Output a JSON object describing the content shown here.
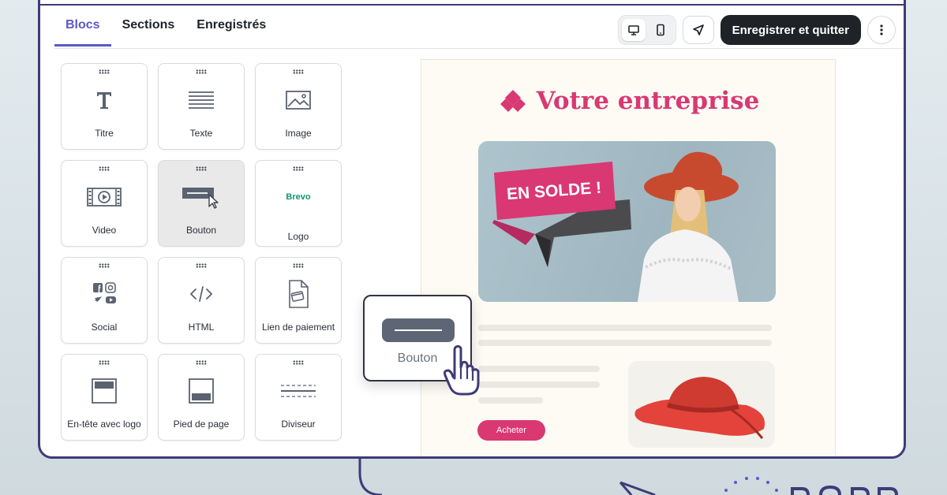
{
  "tabs": [
    "Blocs",
    "Sections",
    "Enregistrés"
  ],
  "toolbar": {
    "save_label": "Enregistrer et quitter"
  },
  "blocks": [
    {
      "label": "Titre"
    },
    {
      "label": "Texte"
    },
    {
      "label": "Image"
    },
    {
      "label": "Video"
    },
    {
      "label": "Bouton"
    },
    {
      "label": "Logo",
      "brand_text": "Brevo"
    },
    {
      "label": "Social"
    },
    {
      "label": "HTML"
    },
    {
      "label": "Lien de paiement"
    },
    {
      "label": "En-tête avec logo"
    },
    {
      "label": "Pied de page"
    },
    {
      "label": "Diviseur"
    }
  ],
  "preview": {
    "brand_name": "Votre entreprise",
    "hero_banner": "EN SOLDE !",
    "cta_label": "Acheter"
  },
  "drag": {
    "label": "Bouton"
  },
  "colors": {
    "accent": "#5b59c7",
    "brand": "#d93873",
    "dark": "#1f2328",
    "frame": "#3f3b77"
  }
}
